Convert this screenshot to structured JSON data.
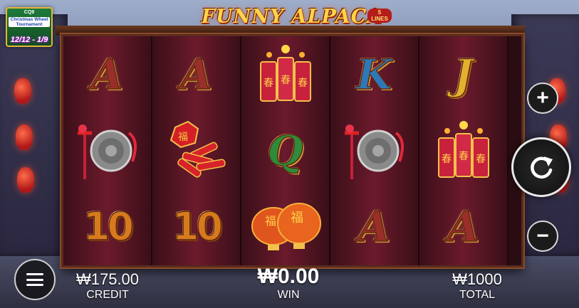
{
  "game": {
    "title": "FUNNY ALPACA",
    "lines_badge": "5 LINES"
  },
  "promo": {
    "header": "CQ9",
    "text": "Christmas Wheel Tournament",
    "dates": "12/12 - 1/9"
  },
  "reels": [
    [
      {
        "symbol": "A",
        "icon": "letter-a"
      },
      {
        "symbol": "gong",
        "icon": "gong-icon"
      },
      {
        "symbol": "10",
        "icon": "number-10"
      }
    ],
    [
      {
        "symbol": "A",
        "icon": "letter-a"
      },
      {
        "symbol": "firecracker-bundle",
        "icon": "firecracker-bundle-icon"
      },
      {
        "symbol": "10",
        "icon": "number-10"
      }
    ],
    [
      {
        "symbol": "firecrackers",
        "icon": "firecrackers-icon"
      },
      {
        "symbol": "Q",
        "icon": "letter-q"
      },
      {
        "symbol": "lanterns",
        "icon": "lanterns-icon"
      }
    ],
    [
      {
        "symbol": "K",
        "icon": "letter-k"
      },
      {
        "symbol": "gong",
        "icon": "gong-icon"
      },
      {
        "symbol": "A",
        "icon": "letter-a"
      }
    ],
    [
      {
        "symbol": "J",
        "icon": "letter-j"
      },
      {
        "symbol": "firecrackers",
        "icon": "firecrackers-icon"
      },
      {
        "symbol": "A",
        "icon": "letter-a"
      }
    ]
  ],
  "stats": {
    "credit_value": "₩175.00",
    "credit_label": "CREDIT",
    "win_value": "₩0.00",
    "win_label": "WIN",
    "total_value": "₩1000",
    "total_label": "TOTAL"
  },
  "controls": {
    "plus": "+",
    "minus": "−",
    "menu_icon": "hamburger-menu-icon",
    "spin_icon": "spin-icon"
  }
}
